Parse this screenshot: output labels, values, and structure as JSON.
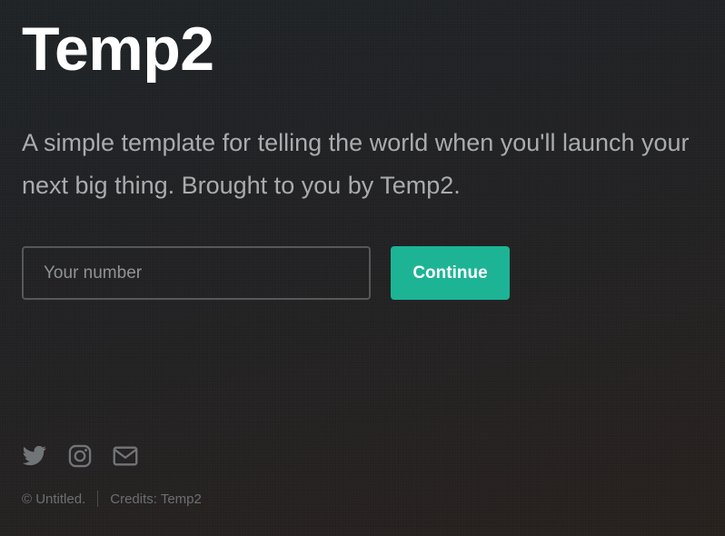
{
  "hero": {
    "title": "Temp2",
    "tagline": "A simple template for telling the world when you'll launch your next big thing. Brought to you by Temp2."
  },
  "form": {
    "input_placeholder": "Your number",
    "input_value": "",
    "submit_label": "Continue"
  },
  "social": {
    "icons": [
      "twitter-icon",
      "instagram-icon",
      "email-icon"
    ]
  },
  "footer": {
    "copyright": "© Untitled.",
    "credits": "Credits: Temp2"
  },
  "colors": {
    "accent": "#1cb495",
    "text_muted": "#a9acae",
    "icon": "#727578",
    "footer_text": "#6c6f72"
  }
}
